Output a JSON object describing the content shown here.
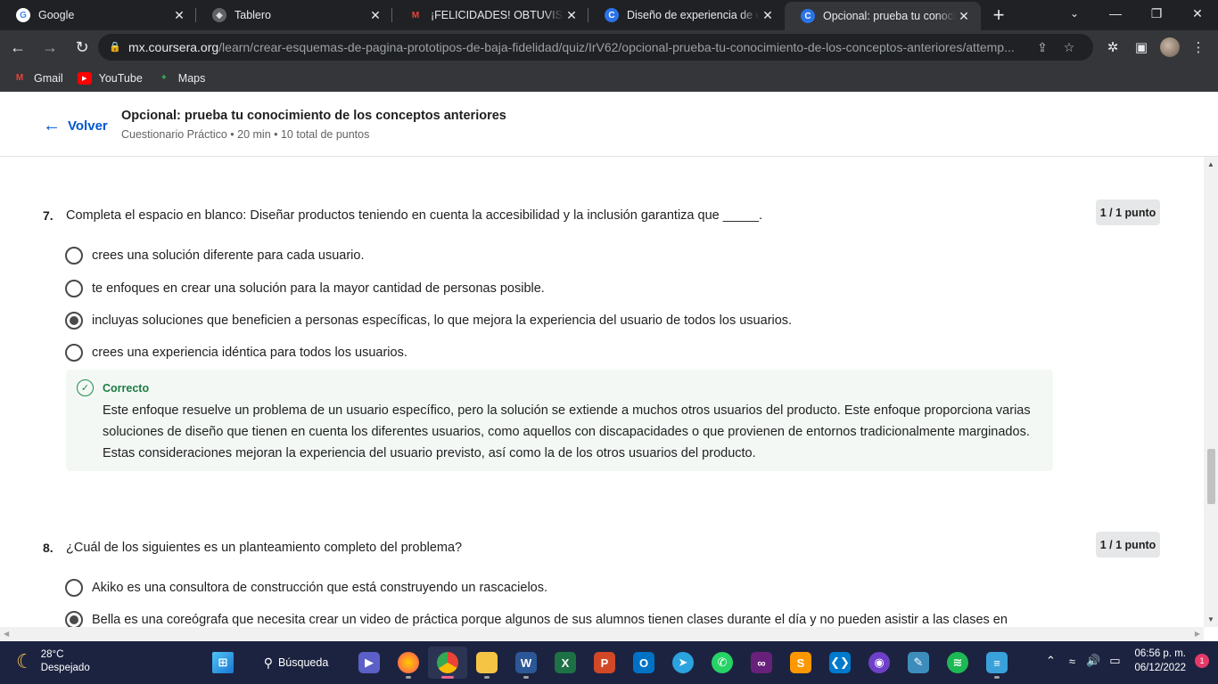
{
  "browser": {
    "tabs": [
      {
        "title": "Google",
        "favicon": "google-icon",
        "active": false
      },
      {
        "title": "Tablero",
        "favicon": "tablero-icon",
        "active": false
      },
      {
        "title": "¡FELICIDADES! OBTUVISTE LA",
        "favicon": "gmail-icon",
        "active": false
      },
      {
        "title": "Diseño de experiencia de usu",
        "favicon": "coursera-icon",
        "active": false
      },
      {
        "title": "Opcional: prueba tu conocim",
        "favicon": "coursera-icon",
        "active": true
      }
    ],
    "url_host": "mx.coursera.org",
    "url_path": "/learn/crear-esquemas-de-pagina-prototipos-de-baja-fidelidad/quiz/IrV62/opcional-prueba-tu-conocimiento-de-los-conceptos-anteriores/attemp...",
    "bookmarks": [
      {
        "label": "Gmail",
        "icon": "gmail-icon"
      },
      {
        "label": "YouTube",
        "icon": "youtube-icon"
      },
      {
        "label": "Maps",
        "icon": "maps-icon"
      }
    ]
  },
  "header": {
    "back_label": "Volver",
    "title": "Opcional: prueba tu conocimiento de los conceptos anteriores",
    "subtitle": "Cuestionario Práctico • 20 min • 10 total de puntos"
  },
  "questions": [
    {
      "number": "7.",
      "text": "Completa el espacio en blanco: Diseñar productos teniendo en cuenta la accesibilidad y la inclusión garantiza que _____.",
      "points": "1 / 1 punto",
      "options": [
        {
          "label": "crees una solución diferente para cada usuario.",
          "selected": false
        },
        {
          "label": "te enfoques en crear una solución para la mayor cantidad de personas posible.",
          "selected": false
        },
        {
          "label": "incluyas soluciones que beneficien a personas específicas, lo que mejora la experiencia del usuario de todos los usuarios.",
          "selected": true
        },
        {
          "label": "crees una experiencia idéntica para todos los usuarios.",
          "selected": false
        }
      ],
      "feedback": {
        "status": "Correcto",
        "text": "Este enfoque resuelve un problema de un usuario específico, pero la solución se extiende a muchos otros usuarios del producto. Este enfoque proporciona varias soluciones de diseño que tienen en cuenta los diferentes usuarios, como aquellos con discapacidades o que provienen de entornos tradicionalmente marginados. Estas consideraciones mejoran la experiencia del usuario previsto, así como la de los otros usuarios del producto."
      }
    },
    {
      "number": "8.",
      "text": "¿Cuál de los siguientes es un planteamiento completo del problema?",
      "points": "1 / 1 punto",
      "options": [
        {
          "label": "Akiko es una consultora de construcción que está construyendo un rascacielos.",
          "selected": false
        },
        {
          "label": "Bella es una coreógrafa que necesita crear un video de práctica porque algunos de sus alumnos tienen clases durante el día y no pueden asistir a las clases en",
          "selected": true
        }
      ]
    }
  ],
  "taskbar": {
    "temperature": "28°C",
    "weather": "Despejado",
    "search_label": "Búsqueda",
    "time": "06:56 p. m.",
    "date": "06/12/2022",
    "notification_count": "1"
  },
  "colors": {
    "brand": "#0056d2",
    "correct": "#1e7b42",
    "feedback_bg": "#f3f8f5"
  }
}
